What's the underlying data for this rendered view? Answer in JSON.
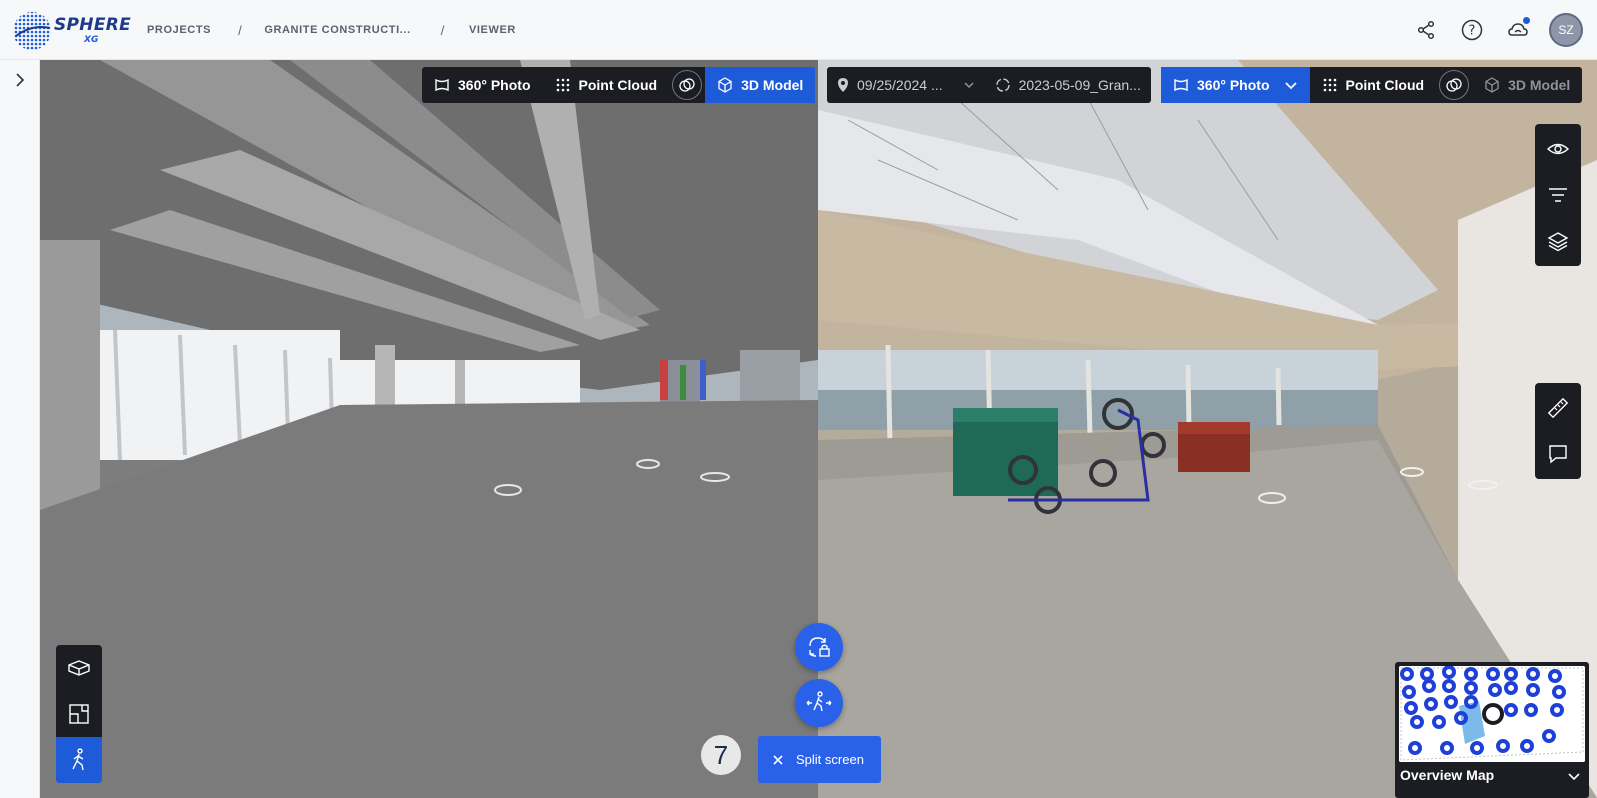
{
  "header": {
    "logo": "SPHERE",
    "logo_sub": "XG",
    "breadcrumbs": [
      "PROJECTS",
      "GRANITE CONSTRUCTI...",
      "VIEWER"
    ],
    "separator": "/",
    "user_initials": "SZ"
  },
  "left_view": {
    "toolbar": {
      "photo_label": "360° Photo",
      "cloud_label": "Point Cloud",
      "model_label": "3D Model",
      "active": "3D Model"
    },
    "side_tools": [
      "3d-box-icon",
      "floorplan-icon",
      "walk-icon"
    ]
  },
  "right_view": {
    "toolbar": {
      "date_value": "09/25/2024 ...",
      "scan_value": "2023-05-09_Gran...",
      "photo_label": "360° Photo",
      "cloud_label": "Point Cloud",
      "model_label": "3D Model",
      "active": "360° Photo"
    },
    "tools_top": [
      "visibility-icon",
      "filter-icon",
      "layers-icon"
    ],
    "tools_mid": [
      "measure-icon",
      "comment-icon"
    ]
  },
  "controls": {
    "sync_lock": "sync-lock-icon",
    "walk_sync": "walk-sync-icon",
    "step_number": "7",
    "split_label": "Split screen"
  },
  "overview": {
    "label": "Overview Map"
  },
  "colors": {
    "accent": "#2962e8",
    "toolbar_bg": "#1b1d22",
    "brand": "#1e3a8a"
  }
}
